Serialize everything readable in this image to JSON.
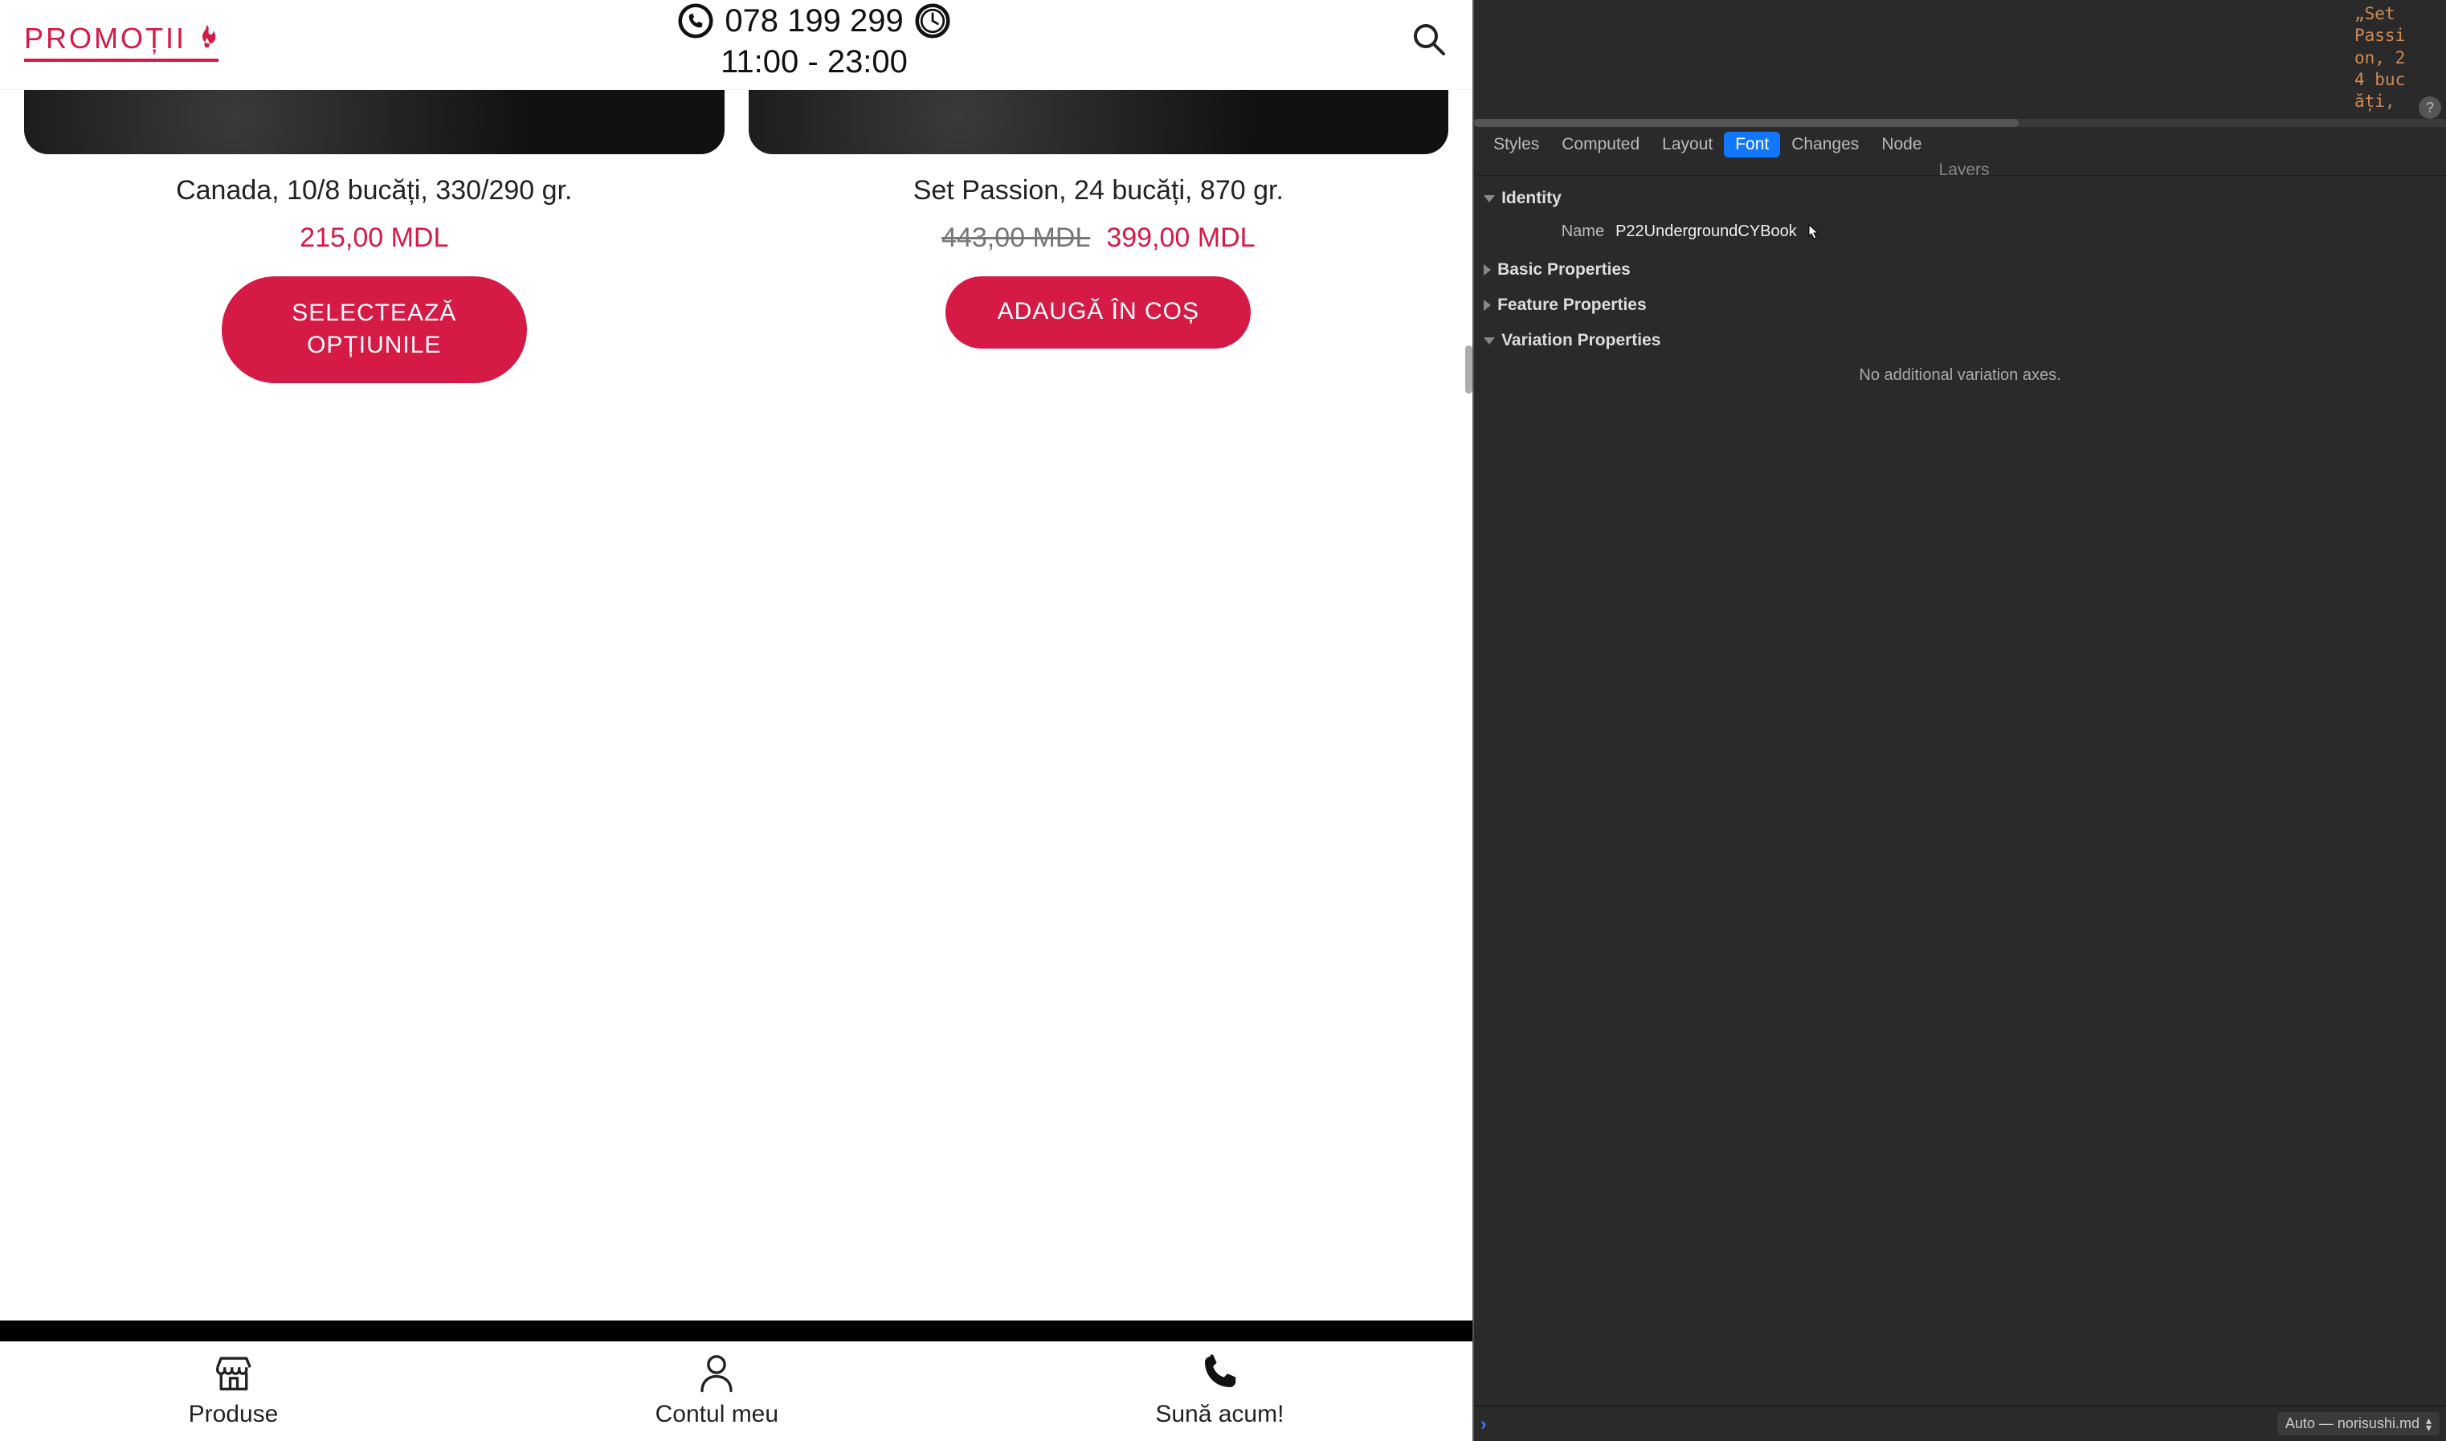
{
  "site": {
    "header": {
      "promo_label": "PROMOȚII",
      "phone": "078 199 299",
      "hours": "11:00 - 23:00"
    },
    "products": [
      {
        "title": "Canada, 10/8 bucăți, 330/290 gr.",
        "old_price": "",
        "price": "215,00 MDL",
        "button": "SELECTEAZĂ OPȚIUNILE"
      },
      {
        "title": "Set Passion, 24 bucăți, 870 gr.",
        "old_price": "443,00 MDL",
        "price": "399,00 MDL",
        "button": "ADAUGĂ ÎN COȘ"
      }
    ],
    "bottom_nav": {
      "produse": "Produse",
      "contul": "Contul meu",
      "suna": "Sună acum!"
    }
  },
  "devtools": {
    "highlighted_text": "„Set Passion, 24 bucăți,",
    "help_label": "?",
    "tabs": {
      "styles": "Styles",
      "computed": "Computed",
      "layout": "Layout",
      "font": "Font",
      "changes": "Changes",
      "node": "Node",
      "row2": "Layers"
    },
    "sections": {
      "identity": "Identity",
      "basic": "Basic Properties",
      "feature": "Feature Properties",
      "variation": "Variation Properties"
    },
    "identity": {
      "name_label": "Name",
      "name_value": "P22UndergroundCYBook"
    },
    "variation_note": "No additional variation axes.",
    "origin_label": "Auto — norisushi.md"
  }
}
